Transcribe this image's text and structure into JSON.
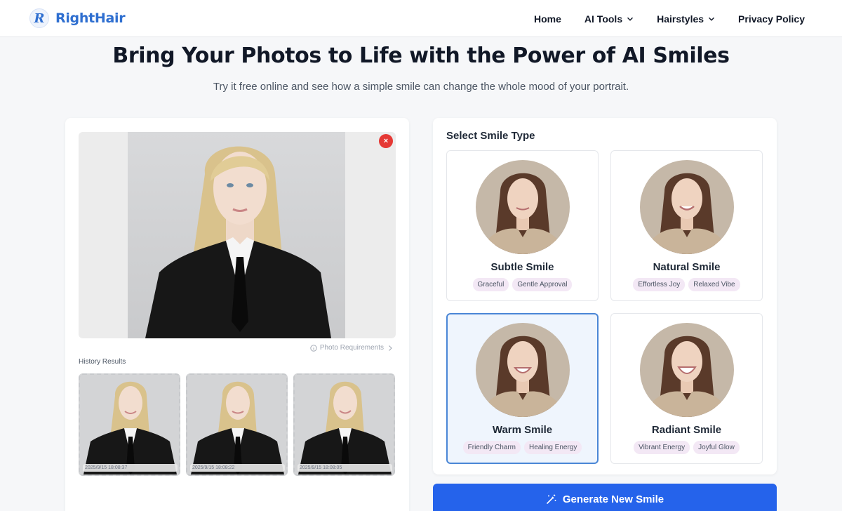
{
  "header": {
    "logo_letter": "R",
    "logo_text": "RightHair",
    "nav": [
      {
        "label": "Home"
      },
      {
        "label": "AI Tools"
      },
      {
        "label": "Hairstyles"
      },
      {
        "label": "Privacy Policy"
      }
    ]
  },
  "hero": {
    "title": "Bring Your Photos to Life with the Power of AI Smiles",
    "subtitle": "Try it free online and see how a simple smile can change the whole mood of your portrait."
  },
  "upload": {
    "remove_label": "×",
    "photo_requirements": "Photo Requirements",
    "history_label": "History Results",
    "history": [
      {
        "timestamp": "2025/9/15 18:08:37"
      },
      {
        "timestamp": "2025/9/15 18:08:22"
      },
      {
        "timestamp": "2025/9/15 18:08:05"
      }
    ]
  },
  "smile_select": {
    "title": "Select Smile Type",
    "options": [
      {
        "name": "Subtle Smile",
        "tags": [
          "Graceful",
          "Gentle Approval"
        ],
        "selected": false
      },
      {
        "name": "Natural Smile",
        "tags": [
          "Effortless Joy",
          "Relaxed Vibe"
        ],
        "selected": false
      },
      {
        "name": "Warm Smile",
        "tags": [
          "Friendly Charm",
          "Healing Energy"
        ],
        "selected": true
      },
      {
        "name": "Radiant Smile",
        "tags": [
          "Vibrant Energy",
          "Joyful Glow"
        ],
        "selected": false
      }
    ]
  },
  "generate": {
    "label": "Generate New Smile"
  },
  "colors": {
    "brand": "#2f6fd0",
    "primary_button": "#2563eb",
    "selected_border": "#4a86d6",
    "remove": "#e53935",
    "tag_bg": "#f3e8f5"
  },
  "icons": {
    "chevron": "chevron-down-icon",
    "info": "info-circle-icon",
    "wand": "magic-wand-icon",
    "close": "close-icon"
  }
}
